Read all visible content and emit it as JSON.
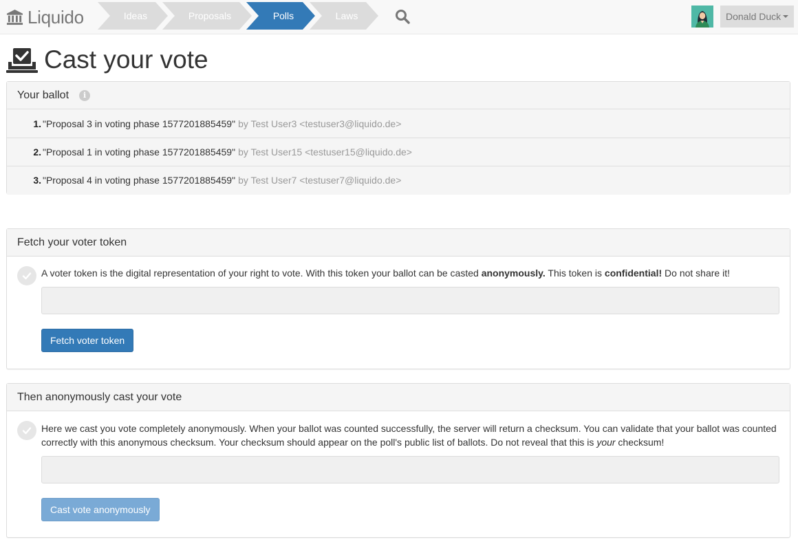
{
  "navbar": {
    "brand": "Liquido",
    "brand_icon": "bank-icon",
    "crumbs": [
      {
        "label": "Ideas",
        "active": false
      },
      {
        "label": "Proposals",
        "active": false
      },
      {
        "label": "Polls",
        "active": true
      },
      {
        "label": "Laws",
        "active": false
      }
    ],
    "search_icon": "search-icon",
    "user_name": "Donald Duck",
    "accent_color": "#337ab7"
  },
  "page": {
    "title": "Cast your vote",
    "title_icon": "ballot-box-check-icon"
  },
  "ballot": {
    "heading": "Your ballot",
    "info_icon": "info-icon",
    "items": [
      {
        "num": "1.",
        "title": "\"Proposal 3 in voting phase 1577201885459\"",
        "by": "by Test User3 <testuser3@liquido.de>"
      },
      {
        "num": "2.",
        "title": "\"Proposal 1 in voting phase 1577201885459\"",
        "by": "by Test User15 <testuser15@liquido.de>"
      },
      {
        "num": "3.",
        "title": "\"Proposal 4 in voting phase 1577201885459\"",
        "by": "by Test User7 <testuser7@liquido.de>"
      }
    ]
  },
  "fetch": {
    "heading": "Fetch your voter token",
    "text_before": "A voter token is the digital representation of your right to vote. With this token your ballot can be casted ",
    "text_bold1": "anonymously.",
    "text_middle": " This token is ",
    "text_bold2": "confidential!",
    "text_after": " Do not share it!",
    "token_value": "",
    "button_label": "Fetch voter token"
  },
  "cast": {
    "heading": "Then anonymously cast your vote",
    "text_before": "Here we cast you vote completely anonymously. When your ballot was counted successfully, the server will return a checksum. You can validate that your ballot was counted correctly with this anonymous checksum. Your checksum should appear on the poll's public list of ballots. Do not reveal that this is ",
    "text_italic": "your",
    "text_after": " checksum!",
    "checksum_value": "",
    "button_label": "Cast vote anonymously"
  }
}
